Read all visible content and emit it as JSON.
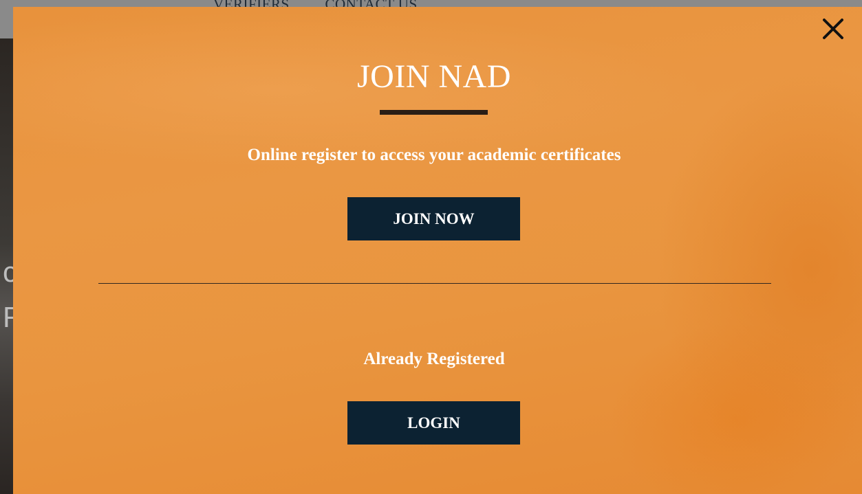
{
  "background_page": {
    "nav_items": [
      "VERIFIERS",
      "CONTACT US"
    ],
    "partial_letters": [
      "c",
      "R"
    ]
  },
  "modal": {
    "title": "JOIN NAD",
    "subtitle": "Online register to access your academic certificates",
    "join_button_label": "JOIN NOW",
    "already_registered_label": "Already Registered",
    "login_button_label": "LOGIN",
    "close_icon": "close-icon",
    "colors": {
      "background": "#e9953f",
      "button": "#0c2232",
      "underline": "#2a1e16",
      "text": "#ffffff"
    }
  }
}
